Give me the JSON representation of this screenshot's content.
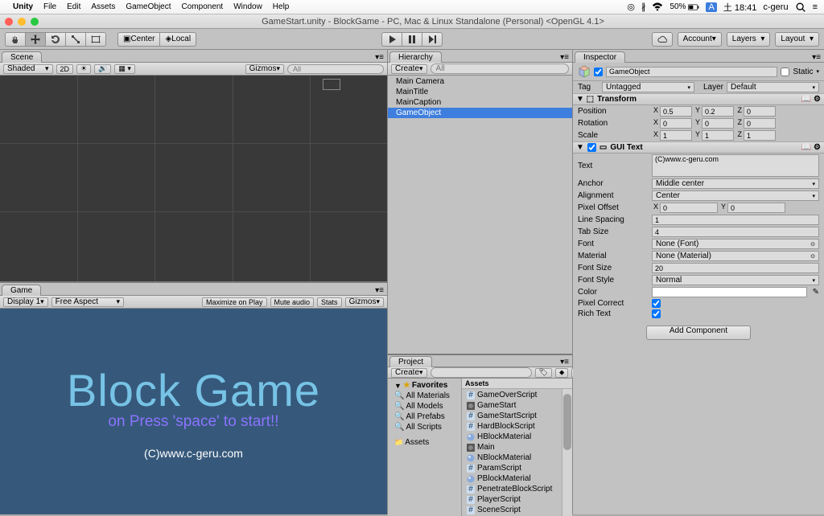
{
  "mac_menu": {
    "app": "Unity",
    "items": [
      "File",
      "Edit",
      "Assets",
      "GameObject",
      "Component",
      "Window",
      "Help"
    ],
    "right": {
      "battery": "50%",
      "ime": "A",
      "time": "土 18:41",
      "user": "c-geru"
    }
  },
  "window_title": "GameStart.unity - BlockGame - PC, Mac & Linux Standalone (Personal) <OpenGL 4.1>",
  "toolbar": {
    "center": "Center",
    "local": "Local",
    "account": "Account",
    "layers": "Layers",
    "layout": "Layout"
  },
  "scene": {
    "tab": "Scene",
    "shaded": "Shaded",
    "_2d": "2D",
    "gizmos": "Gizmos",
    "search": "All"
  },
  "hierarchy": {
    "tab": "Hierarchy",
    "create": "Create",
    "search": "All",
    "items": [
      "Main Camera",
      "MainTitle",
      "MainCaption",
      "GameObject"
    ],
    "selected": 3
  },
  "game": {
    "tab": "Game",
    "display": "Display 1",
    "aspect": "Free Aspect",
    "maximize": "Maximize on Play",
    "mute": "Mute audio",
    "stats": "Stats",
    "gizmos": "Gizmos",
    "title": "Block Game",
    "caption": "on Press 'space' to start!!",
    "copy": "(C)www.c-geru.com"
  },
  "project": {
    "tab": "Project",
    "create": "Create",
    "favorites": {
      "label": "Favorites",
      "items": [
        "All Materials",
        "All Models",
        "All Prefabs",
        "All Scripts"
      ]
    },
    "assets_label": "Assets",
    "assets_header": "Assets",
    "assets": [
      {
        "t": "cs",
        "n": "GameOverScript"
      },
      {
        "t": "scene",
        "n": "GameStart"
      },
      {
        "t": "cs",
        "n": "GameStartScript"
      },
      {
        "t": "cs",
        "n": "HardBlockScript"
      },
      {
        "t": "mat",
        "n": "HBlockMaterial"
      },
      {
        "t": "scene",
        "n": "Main"
      },
      {
        "t": "mat",
        "n": "NBlockMaterial"
      },
      {
        "t": "cs",
        "n": "ParamScript"
      },
      {
        "t": "mat",
        "n": "PBlockMaterial"
      },
      {
        "t": "cs",
        "n": "PenetrateBlockScript"
      },
      {
        "t": "cs",
        "n": "PlayerScript"
      },
      {
        "t": "cs",
        "n": "SceneScript"
      }
    ]
  },
  "inspector": {
    "tab": "Inspector",
    "name": "GameObject",
    "static": "Static",
    "tag_lbl": "Tag",
    "tag_val": "Untagged",
    "layer_lbl": "Layer",
    "layer_val": "Default",
    "transform": {
      "title": "Transform",
      "position": {
        "lbl": "Position",
        "x": "0.5",
        "y": "0.2",
        "z": "0"
      },
      "rotation": {
        "lbl": "Rotation",
        "x": "0",
        "y": "0",
        "z": "0"
      },
      "scale": {
        "lbl": "Scale",
        "x": "1",
        "y": "1",
        "z": "1"
      }
    },
    "guitext": {
      "title": "GUI Text",
      "text_lbl": "Text",
      "text_val": "(C)www.c-geru.com",
      "anchor_lbl": "Anchor",
      "anchor_val": "Middle center",
      "align_lbl": "Alignment",
      "align_val": "Center",
      "pixoff_lbl": "Pixel Offset",
      "pixoff_x": "0",
      "pixoff_y": "0",
      "linesp_lbl": "Line Spacing",
      "linesp_val": "1",
      "tab_lbl": "Tab Size",
      "tab_val": "4",
      "font_lbl": "Font",
      "font_val": "None (Font)",
      "mat_lbl": "Material",
      "mat_val": "None (Material)",
      "fsize_lbl": "Font Size",
      "fsize_val": "20",
      "fstyle_lbl": "Font Style",
      "fstyle_val": "Normal",
      "color_lbl": "Color",
      "pixcorr_lbl": "Pixel Correct",
      "rich_lbl": "Rich Text"
    },
    "add_component": "Add Component"
  }
}
